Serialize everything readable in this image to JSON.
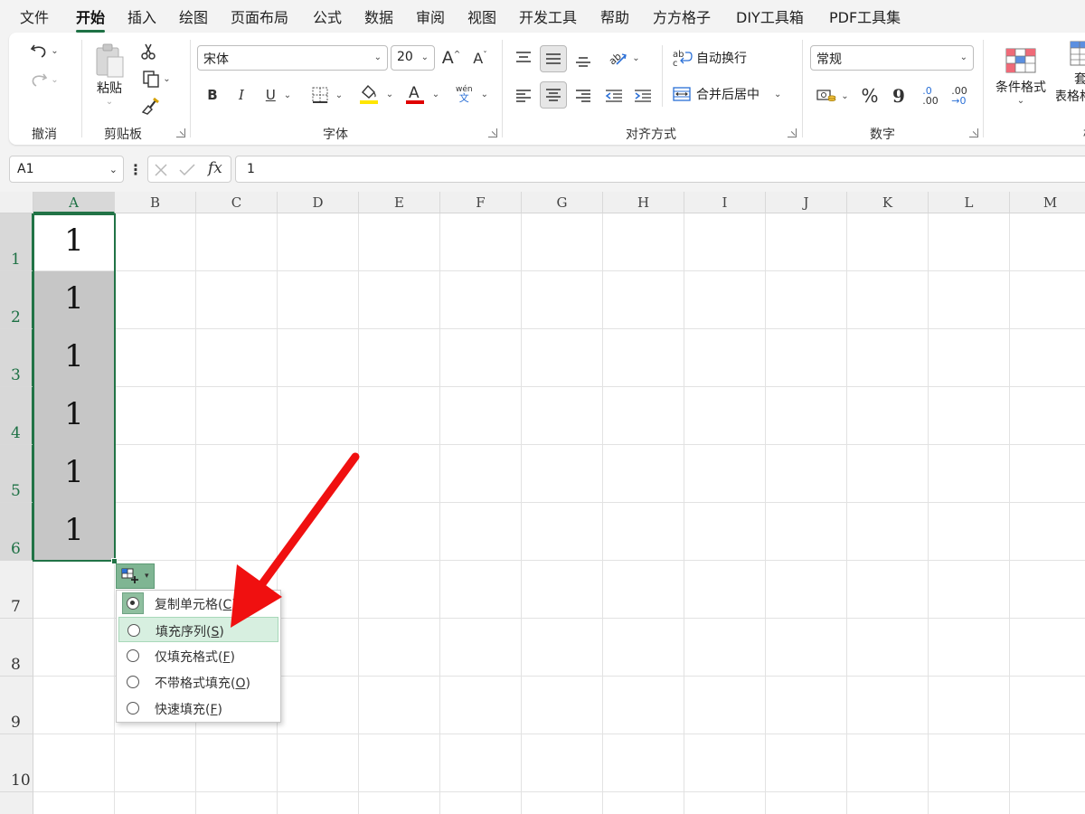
{
  "menu": [
    "文件",
    "开始",
    "插入",
    "绘图",
    "页面布局",
    "公式",
    "数据",
    "审阅",
    "视图",
    "开发工具",
    "帮助",
    "方方格子",
    "DIY工具箱",
    "PDF工具集"
  ],
  "active_menu": "开始",
  "ribbon": {
    "groups": {
      "undo": "撤消",
      "clipboard": "剪贴板",
      "font": "字体",
      "alignment": "对齐方式",
      "number": "数字"
    },
    "paste_label": "粘贴",
    "font_name": "宋体",
    "font_size": "20",
    "bold": "B",
    "italic": "I",
    "underline": "U",
    "font_color_glyph": "A",
    "phonetic_top": "wén",
    "phonetic_bottom": "文",
    "wrap_text": "自动换行",
    "merge_center": "合并后居中",
    "number_format": "常规",
    "percent": "%",
    "comma": "9",
    "inc_decimal_top": ".0",
    "inc_decimal_bottom": ".00",
    "dec_decimal_top": ".00",
    "dec_decimal_bottom": "→0",
    "conditional_format": "条件格式",
    "table_format_top": "套",
    "table_format_bottom": "表格格",
    "cut_off_label": "样"
  },
  "formula_bar": {
    "name_box": "A1",
    "fx": "fx",
    "value": "1"
  },
  "grid": {
    "columns": [
      "A",
      "B",
      "C",
      "D",
      "E",
      "F",
      "G",
      "H",
      "I",
      "J",
      "K",
      "L",
      "M"
    ],
    "rows": [
      "1",
      "2",
      "3",
      "4",
      "5",
      "6",
      "7",
      "8",
      "9",
      "10"
    ],
    "cells": [
      "1",
      "1",
      "1",
      "1",
      "1",
      "1"
    ]
  },
  "autofill_menu": {
    "items": [
      {
        "pre": "复制单元格(",
        "key": "C",
        "post": ")"
      },
      {
        "pre": "填充序列(",
        "key": "S",
        "post": ")"
      },
      {
        "pre": "仅填充格式(",
        "key": "F",
        "post": ")"
      },
      {
        "pre": "不带格式填充(",
        "key": "O",
        "post": ")"
      },
      {
        "pre": "快速填充(",
        "key": "F",
        "post": ")"
      }
    ],
    "checked_index": 0,
    "hover_index": 1
  },
  "colors": {
    "accent": "#217346",
    "highlight_yellow": "#ffe600",
    "font_red": "#e00000",
    "arrow_red": "#f01010"
  }
}
